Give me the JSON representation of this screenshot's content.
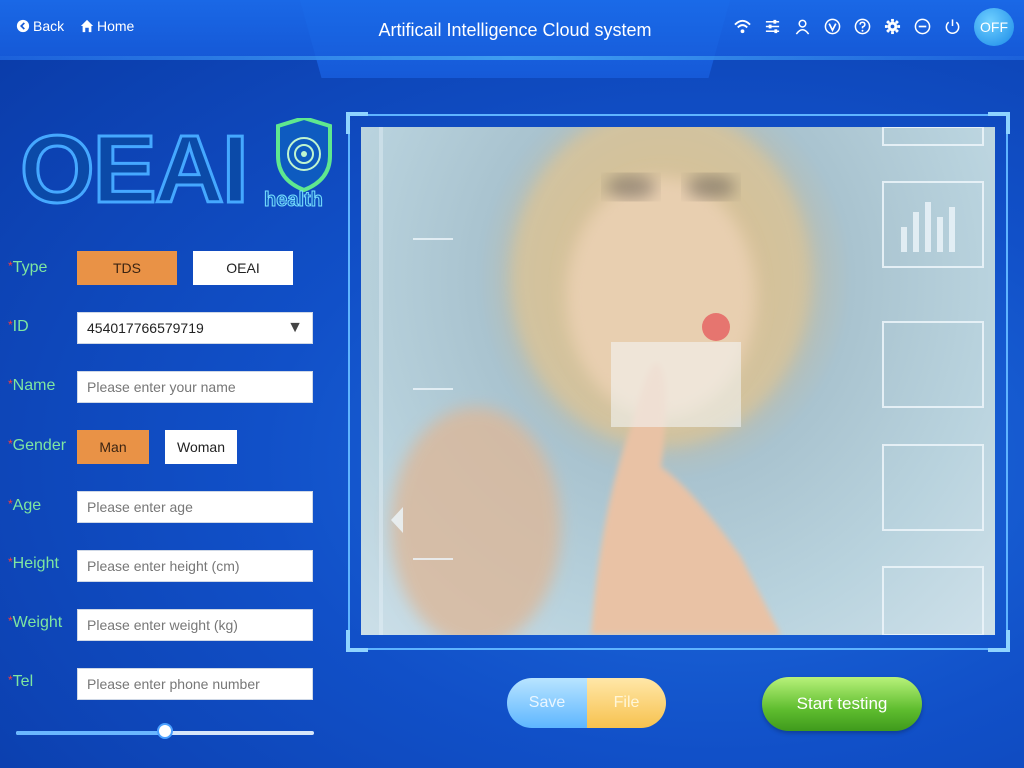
{
  "header": {
    "back_label": "Back",
    "home_label": "Home",
    "title": "Artificail Intelligence Cloud system",
    "power_toggle_label": "OFF",
    "icons": [
      "wifi-icon",
      "sliders-icon",
      "user-icon",
      "v-badge-icon",
      "help-icon",
      "gear-icon",
      "minimize-icon",
      "power-icon"
    ]
  },
  "logo": {
    "main_text": "OEAI",
    "sub_text": "health"
  },
  "form": {
    "type": {
      "label": "Type",
      "options": [
        "TDS",
        "OEAI"
      ],
      "selected": "TDS"
    },
    "id": {
      "label": "ID",
      "value": "454017766579719"
    },
    "name": {
      "label": "Name",
      "placeholder": "Please enter your name"
    },
    "gender": {
      "label": "Gender",
      "options": [
        "Man",
        "Woman"
      ],
      "selected": "Man"
    },
    "age": {
      "label": "Age",
      "placeholder": "Please enter age"
    },
    "height": {
      "label": "Height",
      "placeholder": "Please enter height (cm)"
    },
    "weight": {
      "label": "Weight",
      "placeholder": "Please enter weight (kg)"
    },
    "tel": {
      "label": "Tel",
      "placeholder": "Please enter phone number"
    },
    "required_mark": "*",
    "slider_value": 0.5
  },
  "actions": {
    "save_label": "Save",
    "file_label": "File",
    "start_label": "Start testing"
  },
  "colors": {
    "accent_orange": "#e99246",
    "label_green": "#7ee6a0",
    "start_green": "#5fbd2f"
  }
}
